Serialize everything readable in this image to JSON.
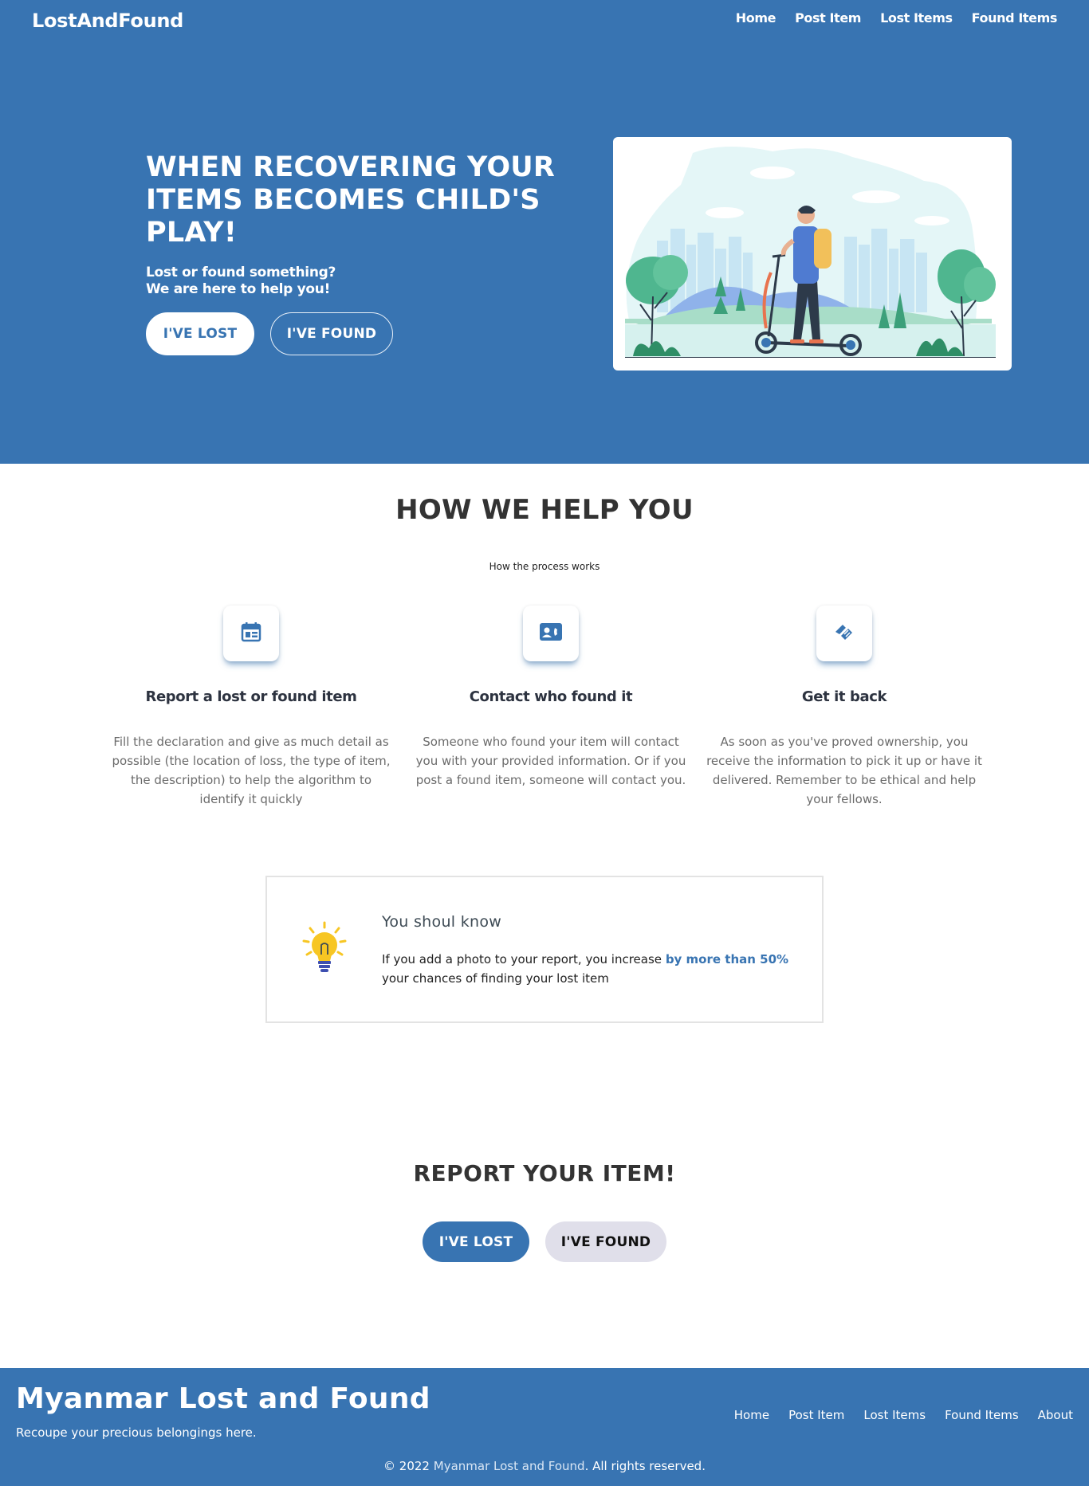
{
  "header": {
    "brand": "LostAndFound",
    "nav": [
      "Home",
      "Post Item",
      "Lost Items",
      "Found Items"
    ]
  },
  "hero": {
    "title": "WHEN RECOVERING YOUR ITEMS BECOMES CHILD'S PLAY!",
    "subtitle_line1": "Lost or found something?",
    "subtitle_line2": "We are here to help you!",
    "lost_button": "I'VE LOST",
    "found_button": "I'VE FOUND"
  },
  "how": {
    "title": "HOW WE HELP YOU",
    "subtitle": "How the process works",
    "steps": [
      {
        "icon": "calendar-table-icon",
        "title": "Report a lost or found item",
        "text": "Fill the declaration and give as much detail as possible (the location of loss, the type of item, the description) to help the algorithm to identify it quickly"
      },
      {
        "icon": "contact-card-icon",
        "title": "Contact who found it",
        "text": "Someone who found your item will contact you with your provided information. Or if you post a found item, someone will contact you."
      },
      {
        "icon": "handshake-icon",
        "title": "Get it back",
        "text": "As soon as you've proved ownership, you receive the information to pick it up or have it delivered. Remember to be ethical and help your fellows."
      }
    ]
  },
  "tip": {
    "icon": "lightbulb-icon",
    "title": "You shoul know",
    "text_before": "If you add a photo to your report, you increase",
    "highlight": "by more than 50%",
    "text_after": "your chances of finding your lost item"
  },
  "report": {
    "title": "REPORT YOUR ITEM!",
    "lost_button": "I'VE LOST",
    "found_button": "I'VE FOUND"
  },
  "footer": {
    "title": "Myanmar Lost and Found",
    "tagline": "Recoupe your precious belongings here.",
    "nav": [
      "Home",
      "Post Item",
      "Lost Items",
      "Found Items",
      "About"
    ],
    "copyright_prefix": "© 2022",
    "copyright_name": "Myanmar Lost and Found",
    "copyright_suffix": ". All rights reserved."
  },
  "colors": {
    "primary": "#3874b2",
    "button_grey": "#e0dfea",
    "bulb": "#f7c623"
  }
}
